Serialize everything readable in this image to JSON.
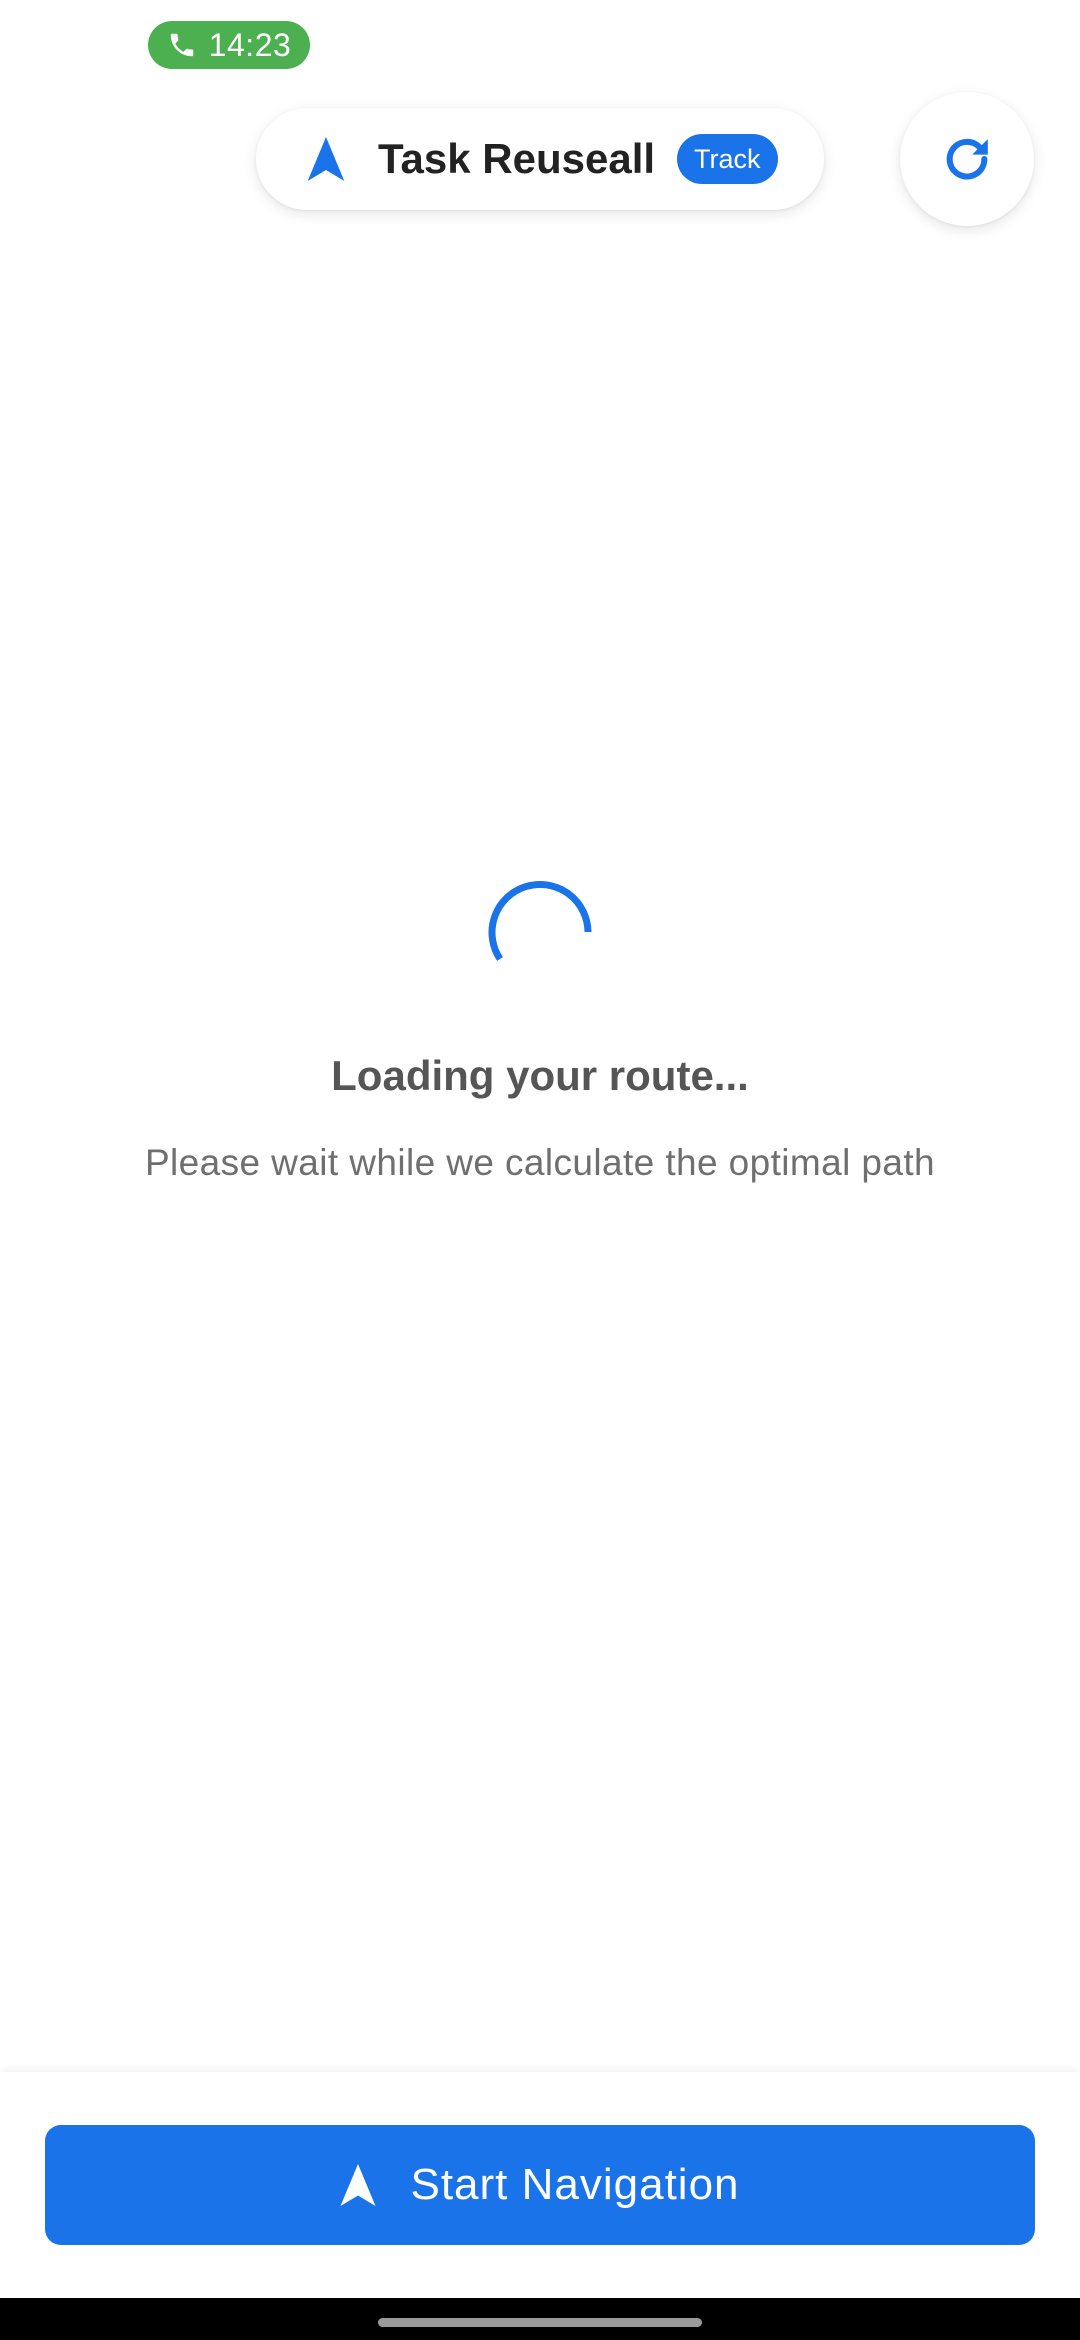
{
  "status_bar": {
    "call_time": "14:23",
    "call_icon": "phone-icon",
    "pill_color": "#4caf50"
  },
  "header": {
    "title": "Task Reuseall",
    "badge": "Track",
    "title_icon": "navigation-arrow-icon",
    "refresh_icon": "refresh-icon"
  },
  "loading": {
    "title": "Loading your route...",
    "subtitle": "Please wait while we calculate the optimal path",
    "spinner_icon": "loading-spinner-icon"
  },
  "actions": {
    "start_label": "Start Navigation",
    "start_icon": "navigation-arrow-icon"
  },
  "colors": {
    "accent": "#1a73e8",
    "background": "#ffffff",
    "title_text": "#222222",
    "secondary_text": "#6f6f6f"
  }
}
